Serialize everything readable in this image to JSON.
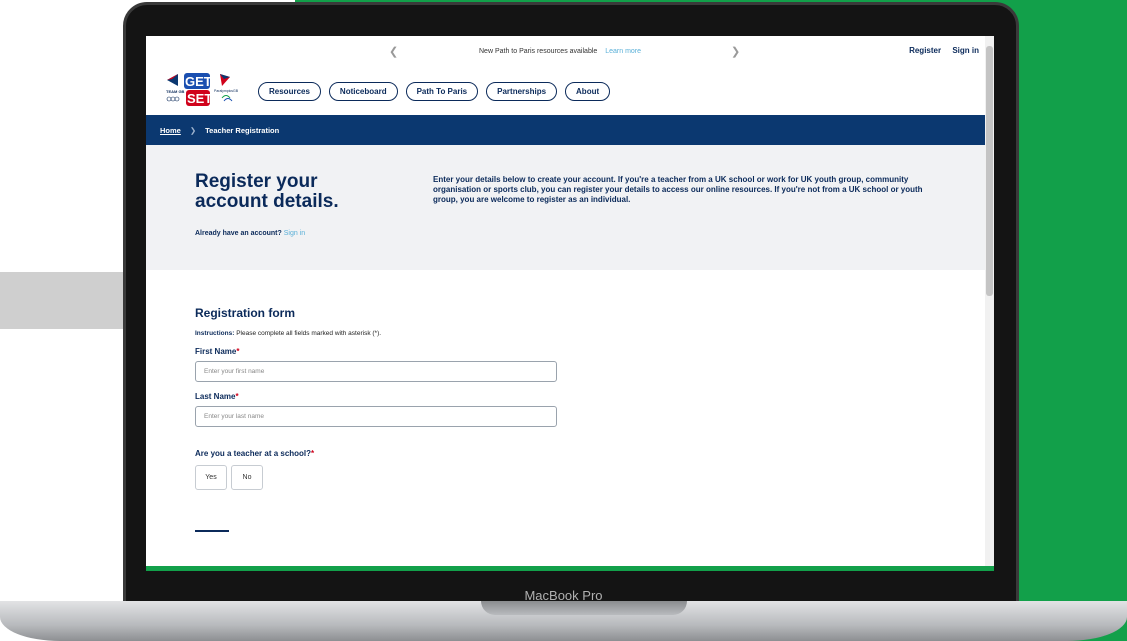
{
  "device": {
    "label": "MacBook Pro"
  },
  "announcement": {
    "message": "New Path to Paris resources available",
    "link": "Learn more"
  },
  "account": {
    "register": "Register",
    "sign_in": "Sign in"
  },
  "nav": {
    "items": [
      {
        "label": "Resources"
      },
      {
        "label": "Noticeboard"
      },
      {
        "label": "Path To Paris"
      },
      {
        "label": "Partnerships"
      },
      {
        "label": "About"
      }
    ]
  },
  "breadcrumb": {
    "home": "Home",
    "current": "Teacher Registration"
  },
  "hero": {
    "title": "Register your account details.",
    "already_text": "Already have an account?",
    "sign_in": "Sign in",
    "intro": "Enter your details below to create your account. If you're a teacher from a UK school or work for UK youth group, community organisation or sports club, you can register your details to access our online resources. If you're not from a UK school or youth group, you are welcome to register as an individual."
  },
  "form": {
    "title": "Registration form",
    "instructions_label": "Instructions:",
    "instructions_text": "Please complete all fields marked with asterisk (*).",
    "first_name": {
      "label": "First Name",
      "placeholder": "Enter your first name"
    },
    "last_name": {
      "label": "Last Name",
      "placeholder": "Enter your last name"
    },
    "teacher_question": "Are you a teacher at a school?",
    "required_mark": "*",
    "yes": "Yes",
    "no": "No"
  },
  "colors": {
    "navy": "#0b2a5a",
    "breadcrumb_bg": "#0b3870",
    "green": "#12a04a",
    "link_blue": "#5ab0d8",
    "required_red": "#d0021b"
  }
}
